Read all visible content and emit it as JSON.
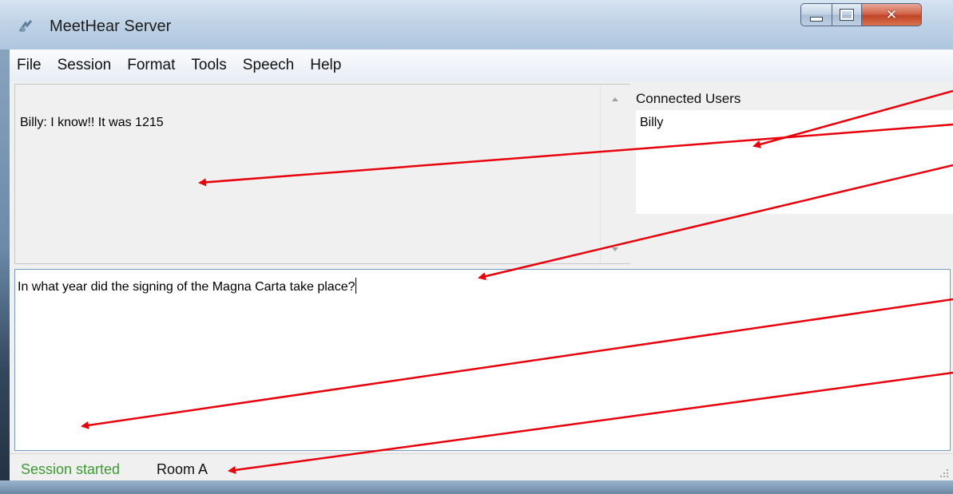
{
  "window": {
    "title": "MeetHear Server",
    "caption_buttons": [
      "minimize",
      "maximize",
      "close"
    ]
  },
  "menubar": {
    "items": [
      "File",
      "Session",
      "Format",
      "Tools",
      "Speech",
      "Help"
    ]
  },
  "log": {
    "text": "Billy: I know!!  It was 1215"
  },
  "users": {
    "label": "Connected Users",
    "list": [
      "Billy"
    ]
  },
  "compose": {
    "value": "In what year did the signing of the Magna Carta take place?"
  },
  "statusbar": {
    "session_status": "Session started",
    "room": "Room A"
  },
  "colors": {
    "annotation_arrow": "#e8000b",
    "status_ok": "#3e9a34"
  },
  "icons": {
    "app": "app-icon",
    "resize_grip": "resize-grip-icon",
    "scroll_up": "scroll-up-arrow-icon",
    "scroll_down": "scroll-down-arrow-icon"
  }
}
